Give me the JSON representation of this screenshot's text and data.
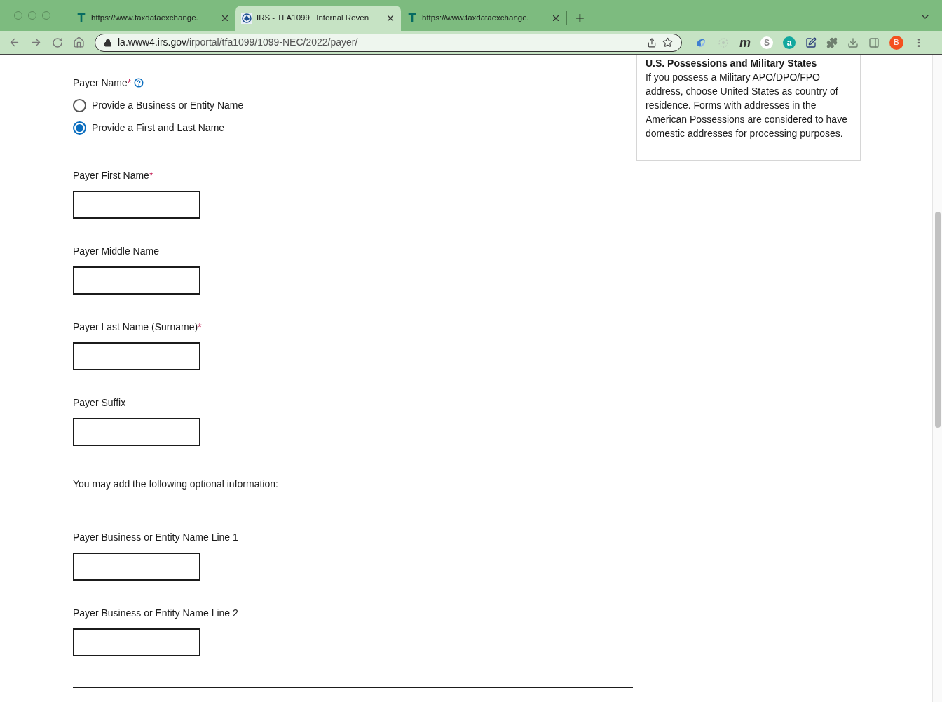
{
  "browser": {
    "tabs": [
      {
        "title": "https://www.taxdataexchange.",
        "kind": "letter",
        "favicon_text": "T",
        "selected": false
      },
      {
        "title": "IRS - TFA1099 | Internal Reven",
        "kind": "seal",
        "selected": true
      },
      {
        "title": "https://www.taxdataexchange.",
        "kind": "letter",
        "favicon_text": "T",
        "selected": false
      }
    ],
    "new_tab": "+",
    "url_host": "la.www4.irs.gov",
    "url_path": "/irportal/tfa1099/1099-NEC/2022/payer/",
    "extensions": [
      {
        "kind": "swirl"
      },
      {
        "kind": "dots"
      },
      {
        "kind": "text",
        "label": "m"
      },
      {
        "kind": "circle",
        "label": "S",
        "color": "#ffffff"
      },
      {
        "kind": "circle",
        "label": "a",
        "color": "#13a89e"
      },
      {
        "kind": "edit"
      },
      {
        "kind": "puzzle"
      }
    ],
    "profile": "B"
  },
  "form": {
    "payer_name": {
      "label": "Payer Name",
      "required_mark": "*",
      "options": [
        {
          "label": "Provide a Business or Entity Name",
          "selected": false
        },
        {
          "label": "Provide a First and Last Name",
          "selected": true
        }
      ]
    },
    "fields_top": [
      {
        "label": "Payer First Name",
        "required_mark": "*"
      },
      {
        "label": "Payer Middle Name"
      },
      {
        "label": "Payer Last Name (Surname)",
        "required_mark": "*"
      },
      {
        "label": "Payer Suffix"
      }
    ],
    "optional_note": "You may add the following optional information:",
    "fields_optional": [
      {
        "label": "Payer Business or Entity Name Line 1"
      },
      {
        "label": "Payer Business or Entity Name Line 2"
      }
    ]
  },
  "help_panel": {
    "title": "U.S. Possessions and Military States",
    "text": "If you possess a Military APO/DPO/FPO address, choose United States as country of residence. Forms with addresses in the American Possessions are considered to have domestic addresses for processing purposes."
  }
}
